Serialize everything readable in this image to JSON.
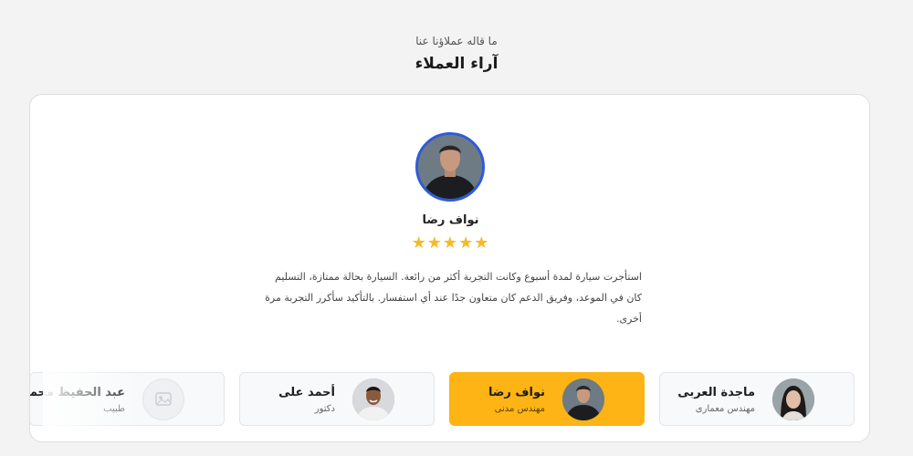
{
  "section": {
    "subtitle": "ما قاله عملاؤنا عنا",
    "title": "آراء العملاء"
  },
  "featured": {
    "name": "نواف رضا",
    "rating": 5,
    "stars": "★★★★★",
    "quote": "استأجرت سيارة لمدة أسبوع وكانت التجربة أكثر من رائعة. السيارة بحالة ممتازة، التسليم كان في الموعد، وفريق الدعم كان متعاون جدًا عند أي استفسار. بالتأكيد سأكرر التجربة مرة أخرى."
  },
  "testimonials": [
    {
      "name": "ماجدة العربى",
      "role": "مهندس معمارى",
      "avatar": "woman-photo",
      "active": false
    },
    {
      "name": "نواف رضا",
      "role": "مهندس مدنى",
      "avatar": "man-dark-hoodie-photo",
      "active": true
    },
    {
      "name": "أحمد على",
      "role": "دكتور",
      "avatar": "smiling-man-photo",
      "active": false
    },
    {
      "name": "عبد الحفيظ محمد",
      "role": "طبيب",
      "avatar": "image-placeholder-icon",
      "active": false
    }
  ],
  "colors": {
    "accent": "#fdb414",
    "star": "#f7b924",
    "avatar_ring": "#2e5bd9"
  }
}
